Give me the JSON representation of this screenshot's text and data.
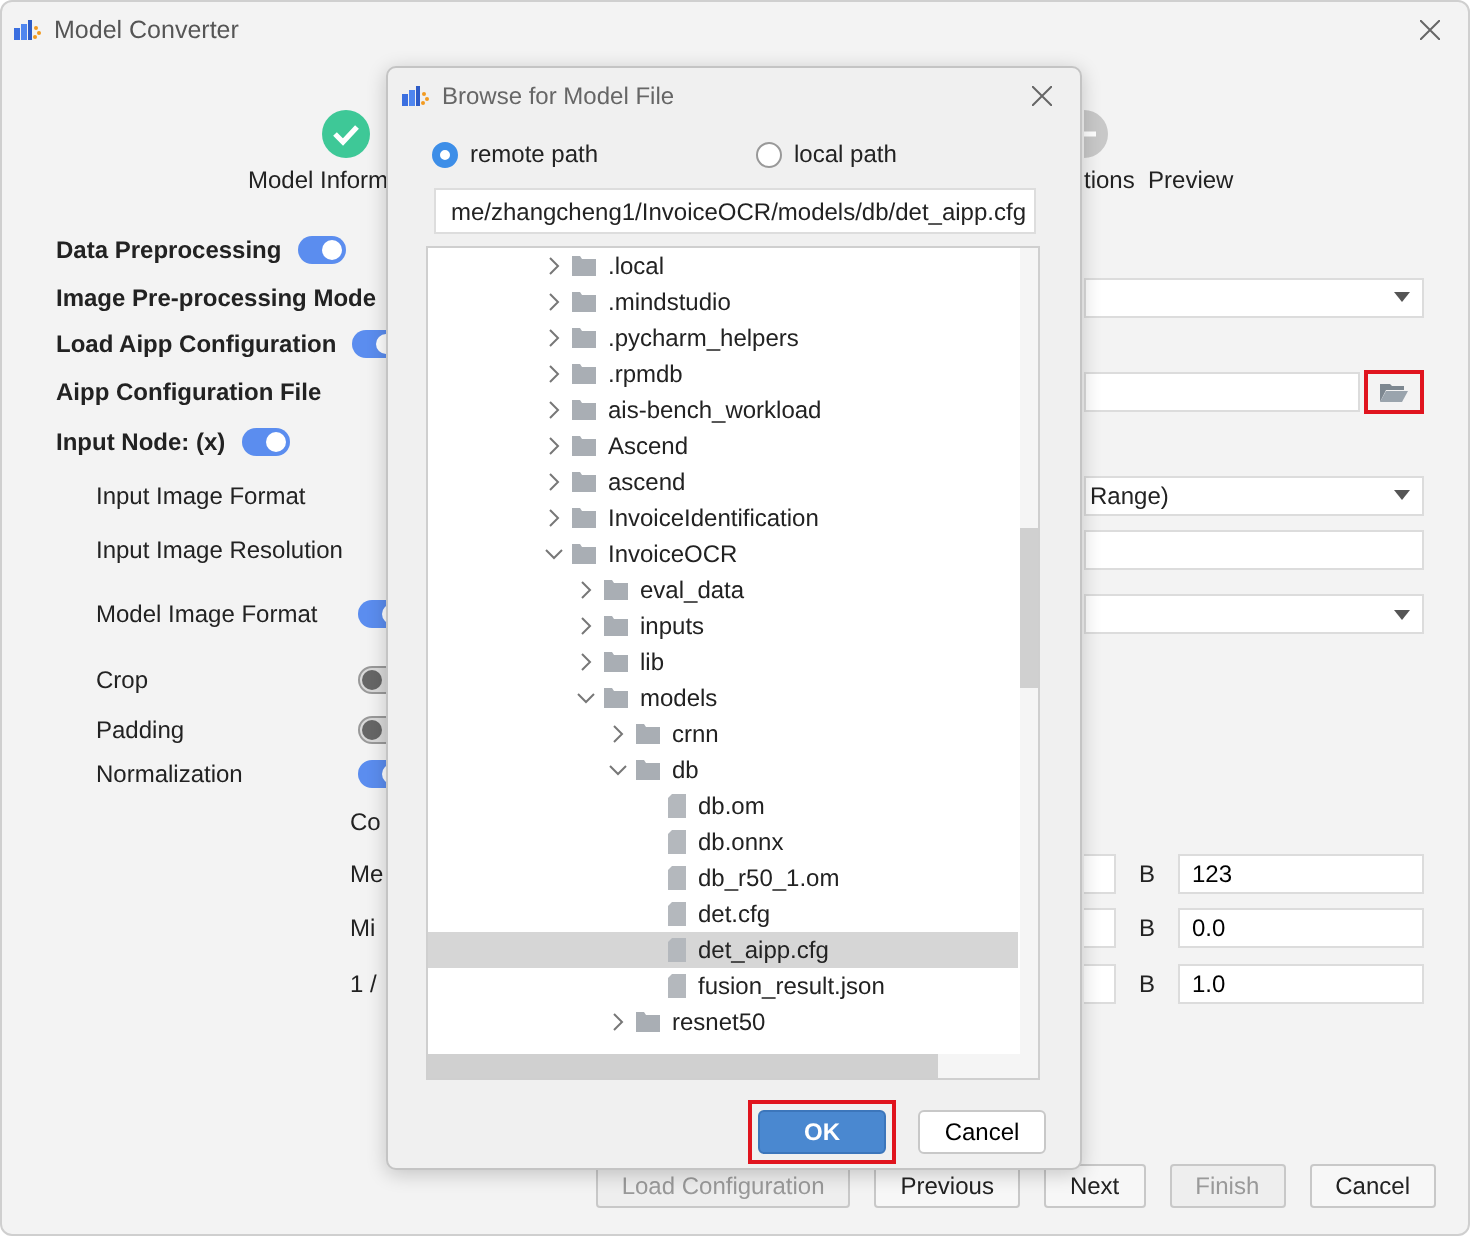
{
  "window": {
    "title": "Model Converter"
  },
  "steps": [
    {
      "label": "Model Inform",
      "kind": "done"
    },
    {
      "label": "tions  Preview",
      "kind": "pending"
    }
  ],
  "form_rows": [
    {
      "kind": "toggle",
      "label": "Data Preprocessing",
      "bold": true,
      "on": true
    },
    {
      "kind": "dropdown",
      "label": "Image Pre-processing Mode",
      "bold": true,
      "value": ""
    },
    {
      "kind": "toggle",
      "label": "Load Aipp Configuration",
      "bold": true,
      "on": true
    },
    {
      "kind": "file",
      "label": "Aipp Configuration File",
      "bold": true,
      "value": "",
      "highlighted": true
    },
    {
      "kind": "toggle",
      "label": "Input Node:   (x)",
      "bold": true,
      "on": true
    },
    {
      "kind": "dropdown",
      "label": "Input Image Format",
      "bold": false,
      "value": "Range)"
    },
    {
      "kind": "text",
      "label": "Input Image Resolution",
      "bold": false,
      "value": ""
    },
    {
      "kind": "toggle_dropdown",
      "label": "Model Image Format",
      "bold": false,
      "on": true,
      "value": ""
    },
    {
      "kind": "toggle",
      "label": "Crop",
      "bold": false,
      "on": false
    },
    {
      "kind": "toggle",
      "label": "Padding",
      "bold": false,
      "on": false
    },
    {
      "kind": "toggle",
      "label": "Normalization",
      "bold": false,
      "on": true
    },
    {
      "kind": "sub_label",
      "label": "Co"
    },
    {
      "kind": "number",
      "label": "Me",
      "channel": "B",
      "value": "123"
    },
    {
      "kind": "number",
      "label": "Mi",
      "channel": "B",
      "value": "0.0"
    },
    {
      "kind": "number",
      "label": "1 /",
      "channel": "B",
      "value": "1.0"
    }
  ],
  "bottom_buttons": [
    {
      "label": "Load Configuration",
      "disabled": true
    },
    {
      "label": "Previous",
      "disabled": false
    },
    {
      "label": "Next",
      "disabled": false
    },
    {
      "label": "Finish",
      "disabled": true
    },
    {
      "label": "Cancel",
      "disabled": false
    }
  ],
  "dialog": {
    "title": "Browse for Model File",
    "sources": [
      {
        "label": "remote path",
        "selected": true
      },
      {
        "label": "local path",
        "selected": false
      }
    ],
    "path": "me/zhangcheng1/InvoiceOCR/models/db/det_aipp.cfg",
    "tree": [
      {
        "name": ".local",
        "kind": "folder",
        "expanded": false,
        "selected": false
      },
      {
        "name": ".mindstudio",
        "kind": "folder",
        "expanded": false,
        "selected": false
      },
      {
        "name": ".pycharm_helpers",
        "kind": "folder",
        "expanded": false,
        "selected": false
      },
      {
        "name": ".rpmdb",
        "kind": "folder",
        "expanded": false,
        "selected": false
      },
      {
        "name": "ais-bench_workload",
        "kind": "folder",
        "expanded": false,
        "selected": false
      },
      {
        "name": "Ascend",
        "kind": "folder",
        "expanded": false,
        "selected": false
      },
      {
        "name": "ascend",
        "kind": "folder",
        "expanded": false,
        "selected": false
      },
      {
        "name": "InvoiceIdentification",
        "kind": "folder",
        "expanded": false,
        "selected": false
      },
      {
        "name": "InvoiceOCR",
        "kind": "folder",
        "expanded": true,
        "selected": false,
        "children": [
          {
            "name": "eval_data",
            "kind": "folder",
            "expanded": false,
            "selected": false
          },
          {
            "name": "inputs",
            "kind": "folder",
            "expanded": false,
            "selected": false
          },
          {
            "name": "lib",
            "kind": "folder",
            "expanded": false,
            "selected": false
          },
          {
            "name": "models",
            "kind": "folder",
            "expanded": true,
            "selected": false,
            "children": [
              {
                "name": "crnn",
                "kind": "folder",
                "expanded": false,
                "selected": false
              },
              {
                "name": "db",
                "kind": "folder",
                "expanded": true,
                "selected": false,
                "children": [
                  {
                    "name": "db.om",
                    "kind": "file",
                    "selected": false
                  },
                  {
                    "name": "db.onnx",
                    "kind": "file",
                    "selected": false
                  },
                  {
                    "name": "db_r50_1.om",
                    "kind": "file",
                    "selected": false
                  },
                  {
                    "name": "det.cfg",
                    "kind": "file",
                    "selected": false
                  },
                  {
                    "name": "det_aipp.cfg",
                    "kind": "file",
                    "selected": true
                  },
                  {
                    "name": "fusion_result.json",
                    "kind": "file",
                    "selected": false
                  }
                ]
              },
              {
                "name": "resnet50",
                "kind": "folder",
                "expanded": false,
                "selected": false
              }
            ]
          }
        ]
      }
    ],
    "buttons": [
      {
        "label": "OK",
        "primary": true,
        "highlighted": true
      },
      {
        "label": "Cancel",
        "primary": false,
        "highlighted": false
      }
    ]
  }
}
